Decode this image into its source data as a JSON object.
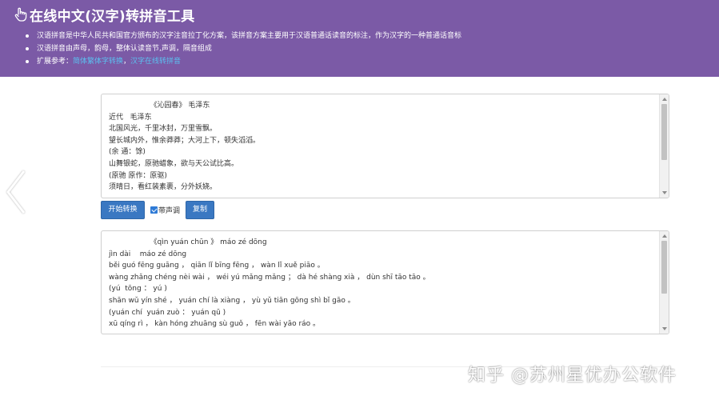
{
  "header": {
    "title": "在线中文(汉字)转拼音工具",
    "title_icon": "hand-pointer-icon",
    "background": "#7b5aa6",
    "bullets": [
      "汉语拼音是中华人民共和国官方颁布的汉字注音拉丁化方案，该拼音方案主要用于汉语普通话读音的标注，作为汉字的一种普通话音标",
      "汉语拼音由声母，韵母，整体认读音节,声调，隔音组成"
    ],
    "reference": {
      "prefix": "扩展参考：",
      "link1": "简体繁体字转换",
      "separator": "，",
      "link2": "汉字在线转拼音",
      "link_color": "#5bc0f0"
    }
  },
  "source": {
    "text": "                  《沁园春》 毛泽东\n近代   毛泽东\n北国风光，千里冰封，万里雪飘。\n望长城内外，惟余莽莽；大河上下，顿失滔滔。\n(余 通：馀)\n山舞银蛇，原驰蜡象，欲与天公试比高。\n(原驰 原作：原驱)\n须晴日，看红装素裹，分外妖娆。"
  },
  "controls": {
    "convert_label": "开始转换",
    "tone_label": "带声调",
    "tone_checked": true,
    "copy_label": "复制",
    "button_color": "#3a78c2"
  },
  "result": {
    "text": "                  《qìn yuán chūn 》 máo zé dōng\njìn dài    máo zé dōng\nběi guó fēng guāng ， qiān lǐ bīng fēng ， wàn lǐ xuě piāo 。\nwàng zhǎng chéng nèi wài ， wéi yú mǎng mǎng ； dà hé shàng xià ， dùn shī tāo tāo 。\n(yú  tōng ： yú )\nshān wǔ yín shé ， yuán chí là xiàng ， yù yǔ tiān gōng shì bǐ gāo 。\n(yuán chí  yuán zuò ： yuán qū )\nxū qíng rì ， kàn hóng zhuāng sù guǒ ， fēn wài yāo ráo 。"
  },
  "watermark": "知乎 @苏州星优办公软件"
}
